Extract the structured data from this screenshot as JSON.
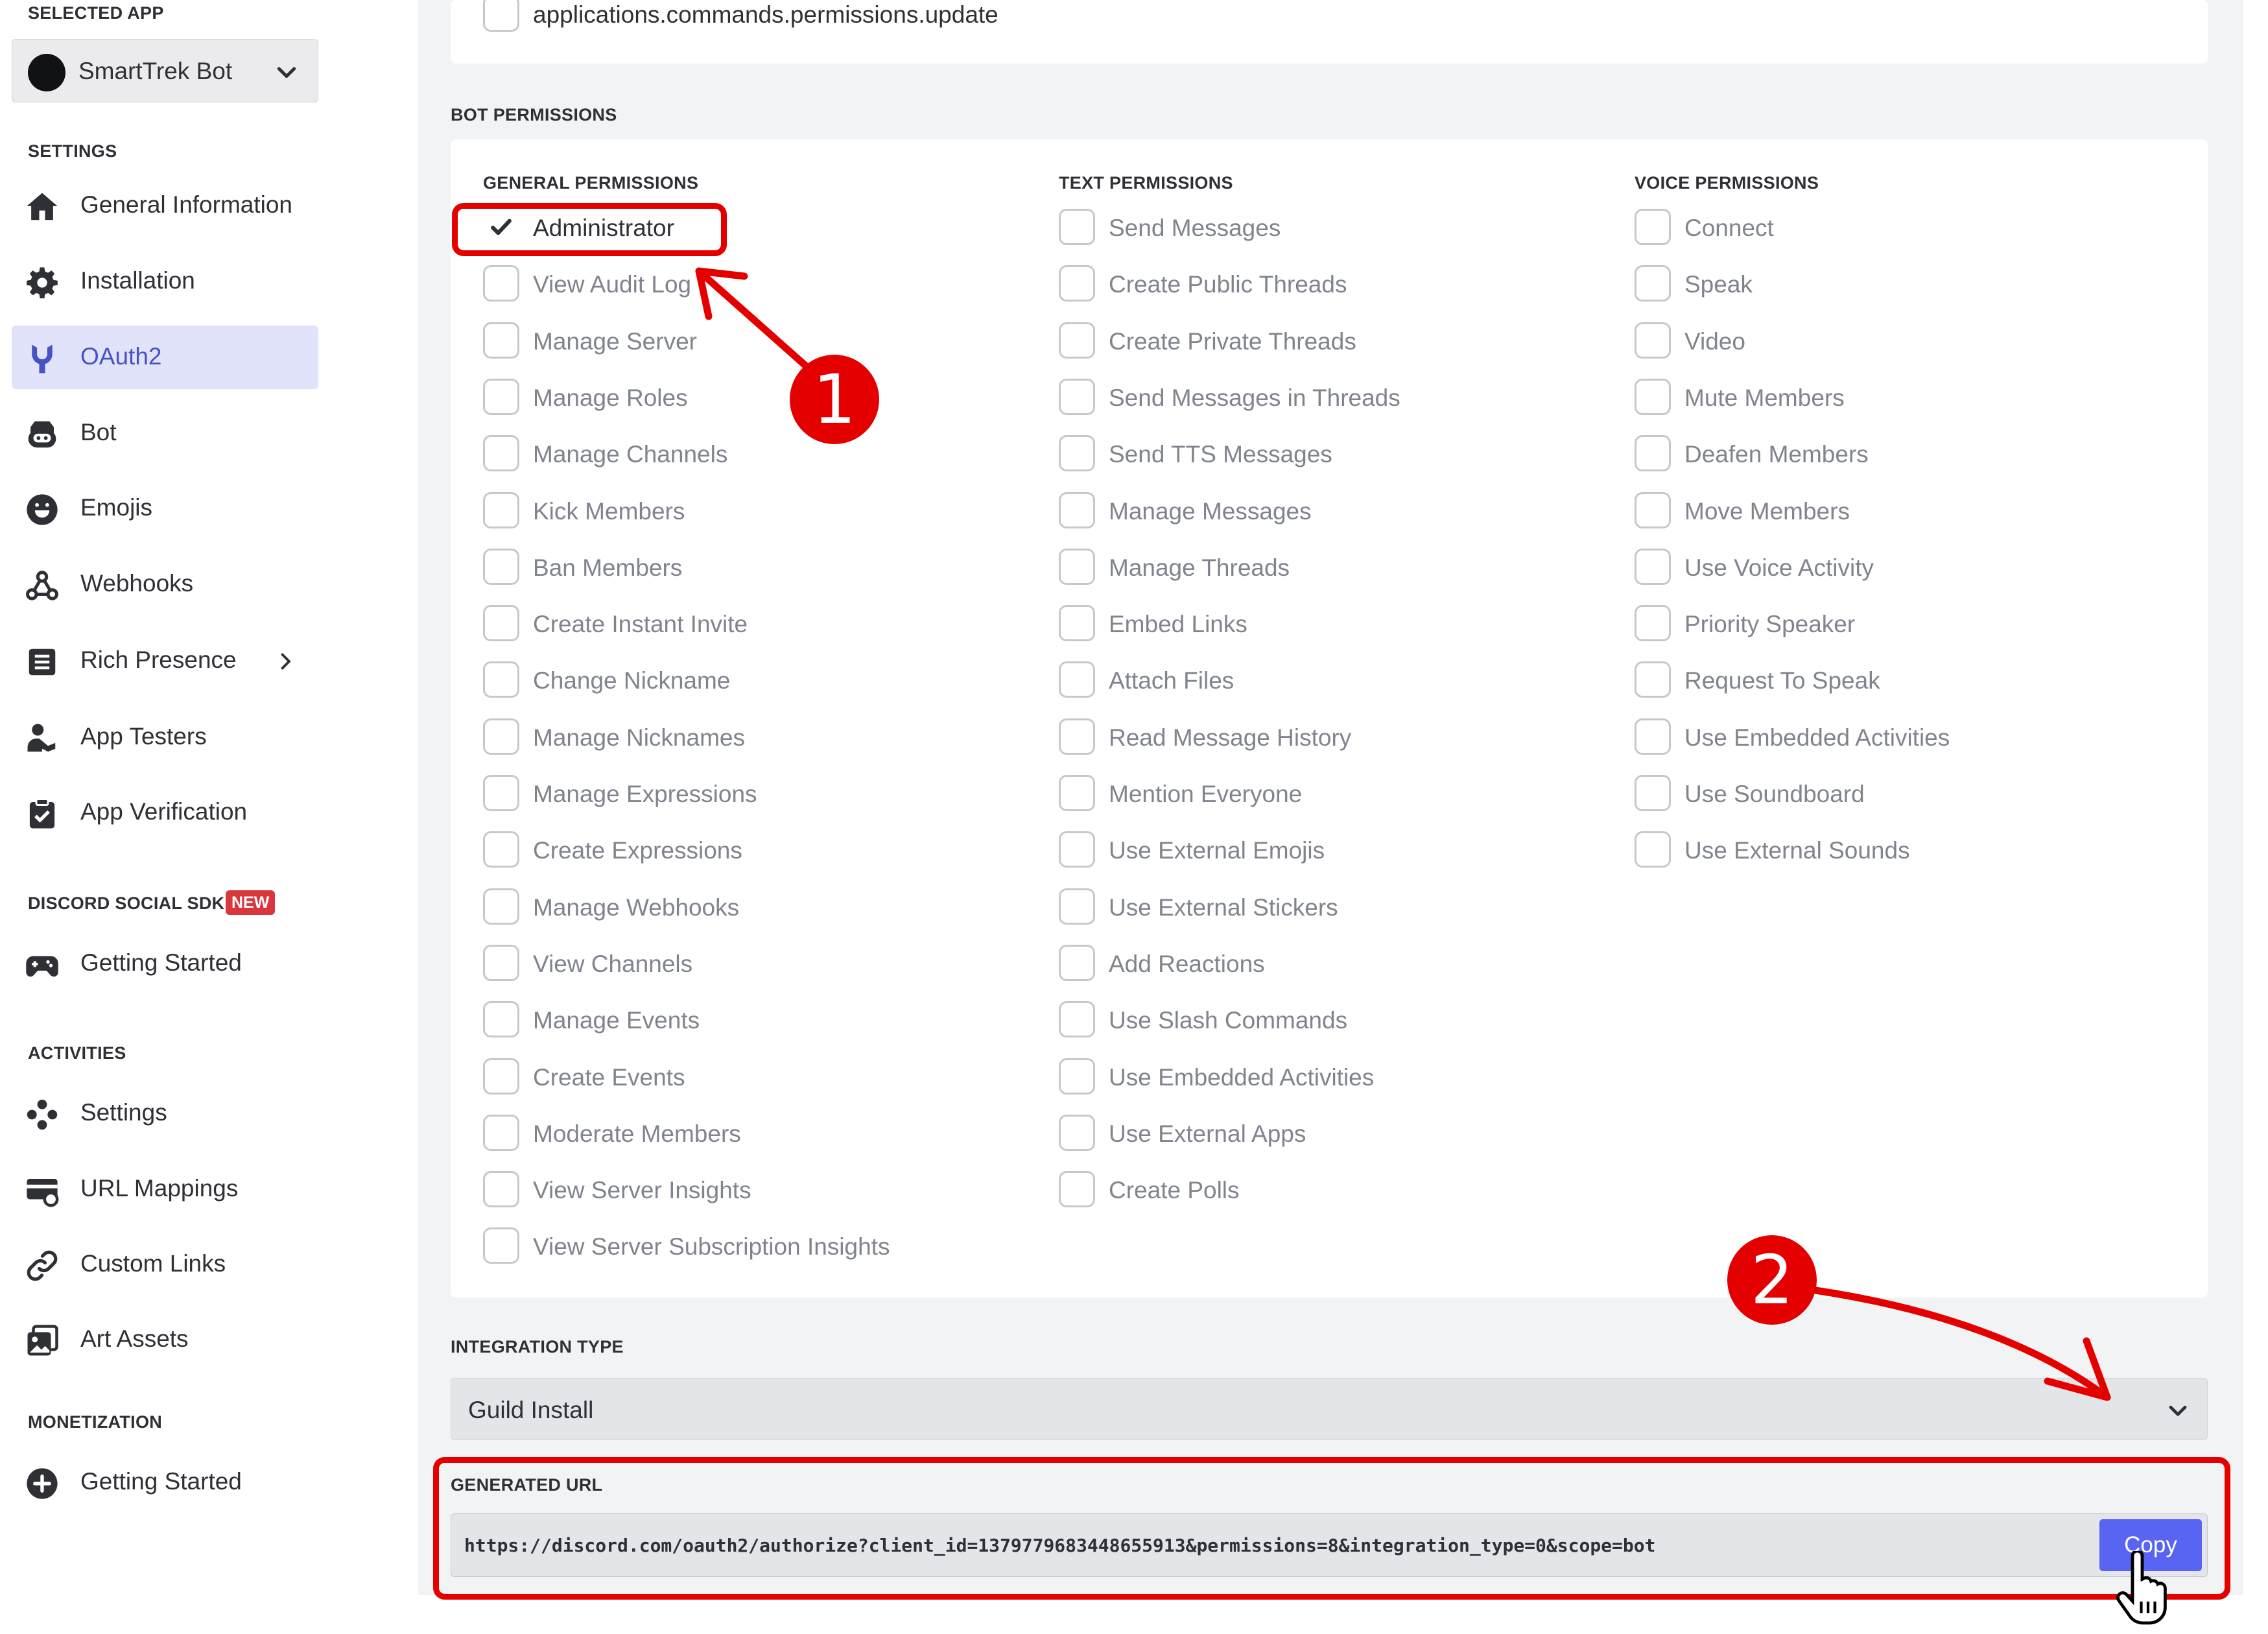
{
  "sidebar": {
    "selected_app_title": "SELECTED APP",
    "app_name": "SmartTrek Bot",
    "settings_title": "SETTINGS",
    "settings_items": [
      {
        "label": "General Information",
        "icon": "home-icon"
      },
      {
        "label": "Installation",
        "icon": "gear-icon"
      },
      {
        "label": "OAuth2",
        "icon": "wrench-icon",
        "active": true
      },
      {
        "label": "Bot",
        "icon": "bot-icon"
      },
      {
        "label": "Emojis",
        "icon": "emoji-icon"
      },
      {
        "label": "Webhooks",
        "icon": "webhook-icon"
      },
      {
        "label": "Rich Presence",
        "icon": "document-icon",
        "has_submenu": true
      },
      {
        "label": "App Testers",
        "icon": "person-icon"
      },
      {
        "label": "App Verification",
        "icon": "clipboard-check-icon"
      }
    ],
    "social_sdk_title": "DISCORD SOCIAL SDK",
    "new_badge": "NEW",
    "social_sdk_items": [
      {
        "label": "Getting Started",
        "icon": "gamepad-icon"
      }
    ],
    "activities_title": "ACTIVITIES",
    "activities_items": [
      {
        "label": "Settings",
        "icon": "controller-icon"
      },
      {
        "label": "URL Mappings",
        "icon": "card-link-icon"
      },
      {
        "label": "Custom Links",
        "icon": "link-icon"
      },
      {
        "label": "Art Assets",
        "icon": "image-icon"
      }
    ],
    "monetization_title": "MONETIZATION",
    "monetization_items": [
      {
        "label": "Getting Started",
        "icon": "plus-circle-icon"
      }
    ]
  },
  "scopes": {
    "last_scope": "applications.commands.permissions.update"
  },
  "bot_permissions": {
    "title": "BOT PERMISSIONS",
    "general": {
      "title": "GENERAL PERMISSIONS",
      "items": [
        {
          "label": "Administrator",
          "checked": true
        },
        {
          "label": "View Audit Log",
          "checked": false
        },
        {
          "label": "Manage Server",
          "checked": false
        },
        {
          "label": "Manage Roles",
          "checked": false
        },
        {
          "label": "Manage Channels",
          "checked": false
        },
        {
          "label": "Kick Members",
          "checked": false
        },
        {
          "label": "Ban Members",
          "checked": false
        },
        {
          "label": "Create Instant Invite",
          "checked": false
        },
        {
          "label": "Change Nickname",
          "checked": false
        },
        {
          "label": "Manage Nicknames",
          "checked": false
        },
        {
          "label": "Manage Expressions",
          "checked": false
        },
        {
          "label": "Create Expressions",
          "checked": false
        },
        {
          "label": "Manage Webhooks",
          "checked": false
        },
        {
          "label": "View Channels",
          "checked": false
        },
        {
          "label": "Manage Events",
          "checked": false
        },
        {
          "label": "Create Events",
          "checked": false
        },
        {
          "label": "Moderate Members",
          "checked": false
        },
        {
          "label": "View Server Insights",
          "checked": false
        },
        {
          "label": "View Server Subscription Insights",
          "checked": false
        }
      ]
    },
    "text": {
      "title": "TEXT PERMISSIONS",
      "items": [
        {
          "label": "Send Messages",
          "checked": false
        },
        {
          "label": "Create Public Threads",
          "checked": false
        },
        {
          "label": "Create Private Threads",
          "checked": false
        },
        {
          "label": "Send Messages in Threads",
          "checked": false
        },
        {
          "label": "Send TTS Messages",
          "checked": false
        },
        {
          "label": "Manage Messages",
          "checked": false
        },
        {
          "label": "Manage Threads",
          "checked": false
        },
        {
          "label": "Embed Links",
          "checked": false
        },
        {
          "label": "Attach Files",
          "checked": false
        },
        {
          "label": "Read Message History",
          "checked": false
        },
        {
          "label": "Mention Everyone",
          "checked": false
        },
        {
          "label": "Use External Emojis",
          "checked": false
        },
        {
          "label": "Use External Stickers",
          "checked": false
        },
        {
          "label": "Add Reactions",
          "checked": false
        },
        {
          "label": "Use Slash Commands",
          "checked": false
        },
        {
          "label": "Use Embedded Activities",
          "checked": false
        },
        {
          "label": "Use External Apps",
          "checked": false
        },
        {
          "label": "Create Polls",
          "checked": false
        }
      ]
    },
    "voice": {
      "title": "VOICE PERMISSIONS",
      "items": [
        {
          "label": "Connect",
          "checked": false
        },
        {
          "label": "Speak",
          "checked": false
        },
        {
          "label": "Video",
          "checked": false
        },
        {
          "label": "Mute Members",
          "checked": false
        },
        {
          "label": "Deafen Members",
          "checked": false
        },
        {
          "label": "Move Members",
          "checked": false
        },
        {
          "label": "Use Voice Activity",
          "checked": false
        },
        {
          "label": "Priority Speaker",
          "checked": false
        },
        {
          "label": "Request To Speak",
          "checked": false
        },
        {
          "label": "Use Embedded Activities",
          "checked": false
        },
        {
          "label": "Use Soundboard",
          "checked": false
        },
        {
          "label": "Use External Sounds",
          "checked": false
        }
      ]
    }
  },
  "integration": {
    "title": "INTEGRATION TYPE",
    "value": "Guild Install"
  },
  "generated_url": {
    "title": "GENERATED URL",
    "url": "https://discord.com/oauth2/authorize?client_id=1379779683448655913&permissions=8&integration_type=0&scope=bot",
    "copy_label": "Copy"
  },
  "annotations": {
    "step1": "1",
    "step2": "2",
    "color": "#e50000"
  },
  "colors": {
    "accent": "#5865f2",
    "active_nav_bg": "#e1e3fa",
    "active_nav_text": "#4752c4",
    "new_badge": "#da373c"
  }
}
